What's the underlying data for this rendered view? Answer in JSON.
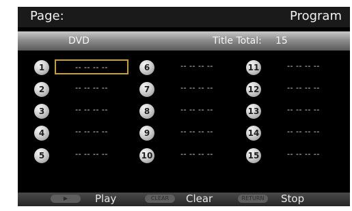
{
  "header": {
    "page_label": "Page:",
    "program_label": "Program"
  },
  "info_bar": {
    "disc_type": "DVD",
    "title_total_label": "Title Total:",
    "title_total_value": "15"
  },
  "slots": [
    {
      "number": "1",
      "value": "-- -- -- --",
      "selected": true
    },
    {
      "number": "2",
      "value": "-- -- -- --"
    },
    {
      "number": "3",
      "value": "-- -- -- --"
    },
    {
      "number": "4",
      "value": "-- -- -- --"
    },
    {
      "number": "5",
      "value": "-- -- -- --"
    },
    {
      "number": "6",
      "value": "-- -- -- --"
    },
    {
      "number": "7",
      "value": "-- -- -- --"
    },
    {
      "number": "8",
      "value": "-- -- -- --"
    },
    {
      "number": "9",
      "value": "-- -- -- --"
    },
    {
      "number": "10",
      "value": "-- -- -- --"
    },
    {
      "number": "11",
      "value": "-- -- -- --"
    },
    {
      "number": "12",
      "value": "-- -- -- --"
    },
    {
      "number": "13",
      "value": "-- -- -- --"
    },
    {
      "number": "14",
      "value": "-- -- -- --"
    },
    {
      "number": "15",
      "value": "-- -- -- --"
    }
  ],
  "footer": {
    "play_key": "▶",
    "play_label": "Play",
    "clear_key": "CLEAR",
    "clear_label": "Clear",
    "return_key": "RETURN",
    "stop_label": "Stop"
  },
  "colors": {
    "selection_border": "#c9a229",
    "background": "#000000"
  }
}
